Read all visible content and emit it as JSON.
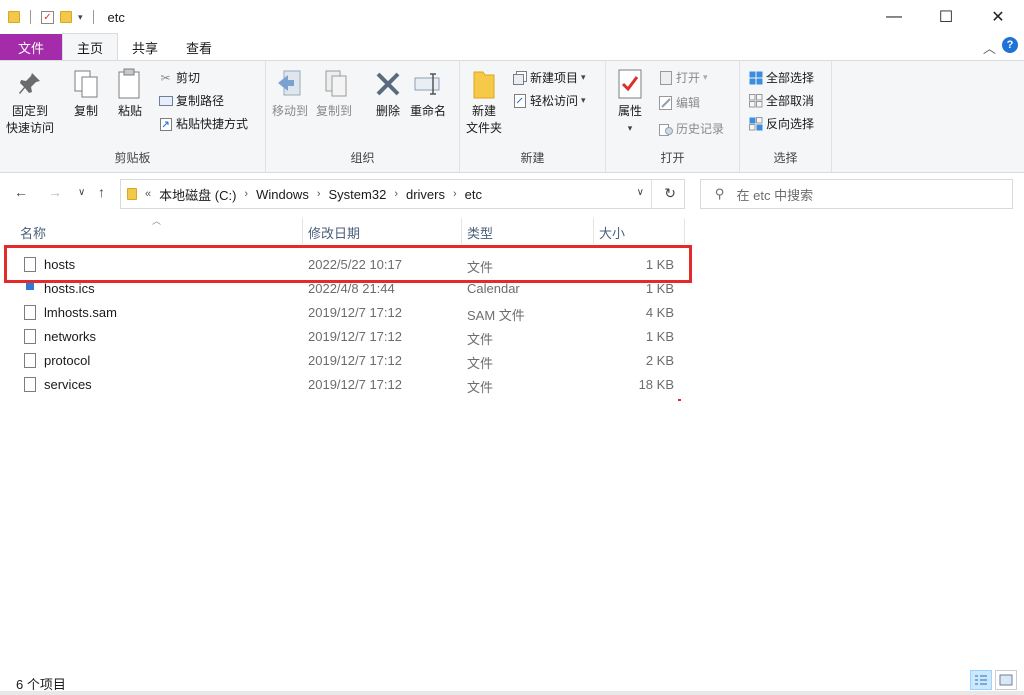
{
  "window": {
    "title": "etc",
    "minimize": "—",
    "maximize": "☐",
    "close": "✕"
  },
  "tabs": {
    "file": "文件",
    "home": "主页",
    "share": "共享",
    "view": "查看"
  },
  "ribbon": {
    "clipboard": {
      "label": "剪贴板",
      "pin_line1": "固定到",
      "pin_line2": "快速访问",
      "copy": "复制",
      "paste": "粘贴",
      "cut": "剪切",
      "copy_path": "复制路径",
      "paste_shortcut": "粘贴快捷方式"
    },
    "organize": {
      "label": "组织",
      "move_to": "移动到",
      "copy_to": "复制到",
      "delete": "删除",
      "rename": "重命名"
    },
    "new": {
      "label": "新建",
      "new_folder_line1": "新建",
      "new_folder_line2": "文件夹",
      "new_item": "新建项目",
      "easy_access": "轻松访问"
    },
    "open": {
      "label": "打开",
      "properties": "属性",
      "open": "打开",
      "edit": "编辑",
      "history": "历史记录"
    },
    "select": {
      "label": "选择",
      "select_all": "全部选择",
      "select_none": "全部取消",
      "invert": "反向选择"
    }
  },
  "address": {
    "prefix": "«",
    "crumbs": [
      "本地磁盘 (C:)",
      "Windows",
      "System32",
      "drivers",
      "etc"
    ],
    "search_placeholder": "在 etc 中搜索"
  },
  "columns": {
    "name": "名称",
    "date": "修改日期",
    "type": "类型",
    "size": "大小"
  },
  "files": [
    {
      "name": "hosts",
      "date": "2022/5/22 10:17",
      "type": "文件",
      "size": "1 KB",
      "icon": "file-icon"
    },
    {
      "name": "hosts.ics",
      "date": "2022/4/8 21:44",
      "type": "Calendar",
      "size": "1 KB",
      "icon": "calendar-file-icon"
    },
    {
      "name": "lmhosts.sam",
      "date": "2019/12/7 17:12",
      "type": "SAM 文件",
      "size": "4 KB",
      "icon": "file-icon"
    },
    {
      "name": "networks",
      "date": "2019/12/7 17:12",
      "type": "文件",
      "size": "1 KB",
      "icon": "file-icon"
    },
    {
      "name": "protocol",
      "date": "2019/12/7 17:12",
      "type": "文件",
      "size": "2 KB",
      "icon": "file-icon"
    },
    {
      "name": "services",
      "date": "2019/12/7 17:12",
      "type": "文件",
      "size": "18 KB",
      "icon": "file-icon"
    }
  ],
  "status": {
    "count": "6 个项目"
  },
  "colors": {
    "file_tab": "#a42ba9",
    "highlight": "#e32b2b",
    "selection": "#99c9ef"
  }
}
